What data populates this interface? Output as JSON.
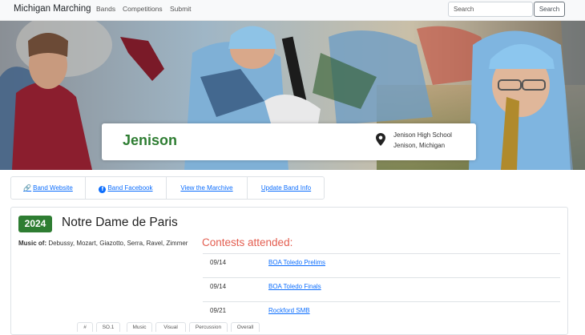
{
  "navbar": {
    "brand": "Michigan Marching",
    "links": [
      "Bands",
      "Competitions",
      "Submit"
    ],
    "search_placeholder": "Search",
    "search_button": "Search"
  },
  "band": {
    "name": "Jenison",
    "school": "Jenison High School",
    "city": "Jenison, Michigan",
    "location_icon": "map-pin-icon"
  },
  "links": {
    "website": "Band Website",
    "facebook": "Band Facebook",
    "marchive": "View the Marchive",
    "update": "Update Band Info"
  },
  "show": {
    "year": "2024",
    "title": "Notre Dame de Paris",
    "music_label": "Music of:",
    "music": "Debussy, Mozart, Giazotto, Serra, Ravel, Zimmer",
    "contests_heading": "Contests attended:",
    "contests": [
      {
        "date": "09/14",
        "name": "BOA Toledo Prelims"
      },
      {
        "date": "09/14",
        "name": "BOA Toledo Finals"
      },
      {
        "date": "09/21",
        "name": "Rockford SMB"
      }
    ],
    "score_tabs": [
      "#",
      "SO.1",
      "Music",
      "Visual",
      "Percussion",
      "Overall"
    ]
  },
  "colors": {
    "accent_green": "#2e7d32",
    "contests_red": "#e35d4f",
    "link_blue": "#0d6efd"
  }
}
